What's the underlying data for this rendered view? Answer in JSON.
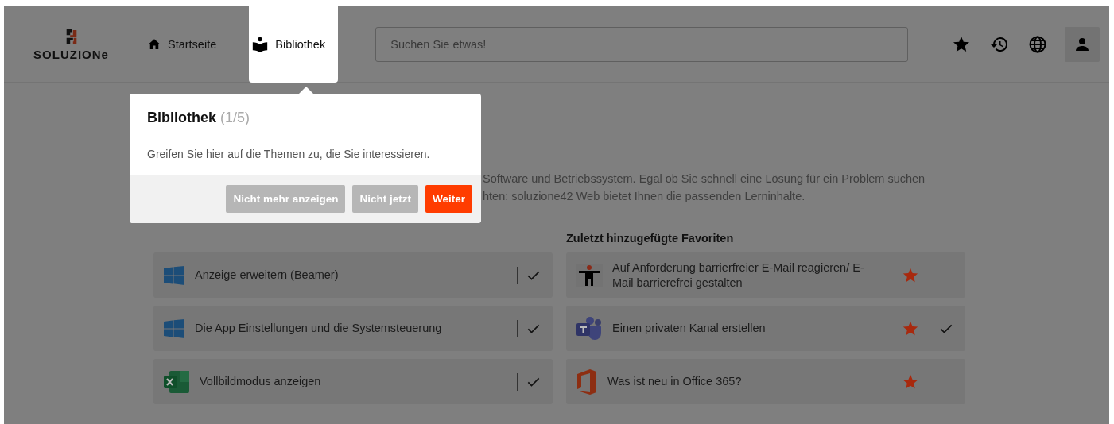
{
  "header": {
    "logo": "SOLUZIONe",
    "nav": [
      {
        "label": "Startseite",
        "kind": "home",
        "selected": false
      },
      {
        "label": "Bibliothek",
        "kind": "library",
        "selected": true
      }
    ],
    "search": {
      "placeholder": "Suchen Sie etwas!"
    },
    "actions": [
      {
        "kind": "star"
      },
      {
        "kind": "history"
      },
      {
        "kind": "globe"
      },
      {
        "kind": "user"
      }
    ]
  },
  "intro": [
    "Software und Betriebssystem. Egal ob Sie schnell eine Lösung für ein Problem suchen",
    "hten: soluzione42 Web bietet Ihnen die passenden Lerninhalte."
  ],
  "columns": [
    {
      "items": [
        {
          "title": "Anzeige erweitern (Beamer)",
          "kind": "windows",
          "favorite": false,
          "done": true
        },
        {
          "title": "Die App Einstellungen und die Systemsteuerung",
          "kind": "windows",
          "favorite": false,
          "done": true
        },
        {
          "title": "Vollbildmodus anzeigen",
          "kind": "excel",
          "favorite": false,
          "done": true
        }
      ]
    },
    {
      "heading": "Zuletzt hinzugefügte Favoriten",
      "items": [
        {
          "title": "Auf Anforderung barrierfreier E-Mail reagieren/ E-Mail barrierefrei gestalten",
          "kind": "accessibility",
          "favorite": true,
          "done": false
        },
        {
          "title": "Einen privaten Kanal erstellen",
          "kind": "teams",
          "favorite": true,
          "done": true
        },
        {
          "title": "Was ist neu in Office 365?",
          "kind": "office",
          "favorite": true,
          "done": false
        }
      ]
    }
  ],
  "tour": {
    "title": "Bibliothek",
    "step": "(1/5)",
    "text": "Greifen Sie hier auf die Themen zu, die Sie interessieren.",
    "buttons": [
      {
        "label": "Nicht mehr anzeigen",
        "kind": "secondary"
      },
      {
        "label": "Nicht jetzt",
        "kind": "secondary"
      },
      {
        "label": "Weiter",
        "kind": "primary"
      }
    ]
  }
}
